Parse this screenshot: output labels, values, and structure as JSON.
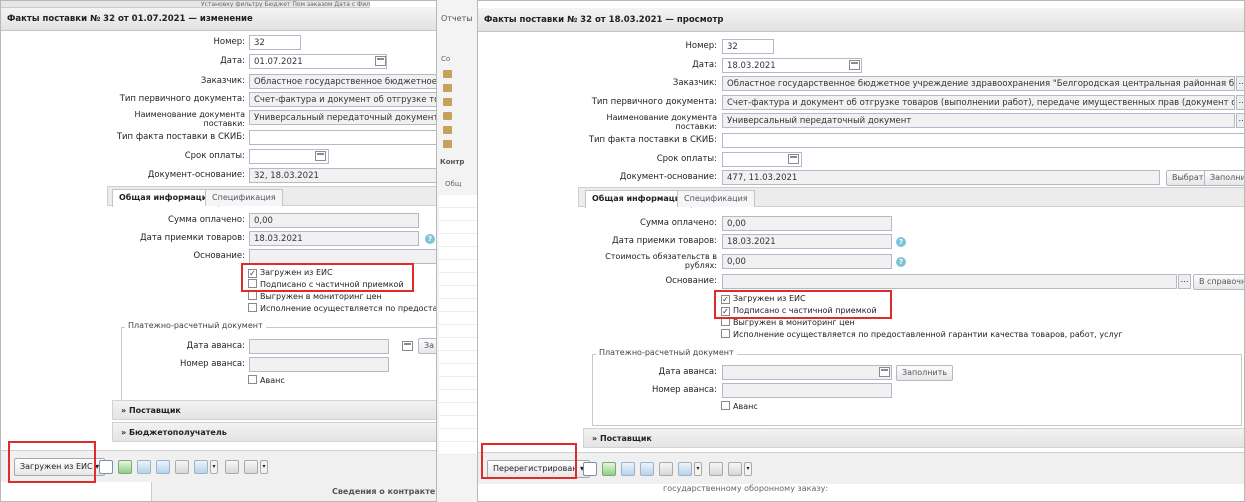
{
  "left": {
    "strip_text": "Установку фильтру Бюджет Пом заказом Дата с Фил",
    "title": "Факты поставки № 32 от 01.07.2021 — изменение",
    "fields": {
      "nomer_label": "Номер:",
      "nomer": "32",
      "data_label": "Дата:",
      "data": "01.07.2021",
      "zakazchik_label": "Заказчик:",
      "zakazchik": "Областное государственное бюджетное учрежд",
      "tip_label": "Тип первичного документа:",
      "tip": "Счет-фактура и документ об отгрузке товаров",
      "naim_label": "Наименование документа поставки:",
      "naim": "Универсальный передаточный документ",
      "skib_label": "Тип факта поставки в СКИБ:",
      "srok_label": "Срок оплаты:",
      "osnov_label": "Документ-основание:",
      "osnov": "32, 18.03.2021"
    },
    "tabs": [
      "Общая информация",
      "Спецификация"
    ],
    "general": {
      "summa_label": "Сумма оплачено:",
      "summa": "0,00",
      "priemka_label": "Дата приемки товаров:",
      "priemka": "18.03.2021",
      "osnovanie_label": "Основание:"
    },
    "checks": [
      {
        "label": "Загружен из ЕИС",
        "checked": true
      },
      {
        "label": "Подписано с частичной приемкой",
        "checked": false
      },
      {
        "label": "Выгружен в мониторинг цен",
        "checked": false
      },
      {
        "label": "Исполнение осуществляется по предоставл",
        "checked": false
      }
    ],
    "payment": {
      "title": "Платежно-расчетный документ",
      "avans_date_label": "Дата аванса:",
      "avans_num_label": "Номер аванса:",
      "avans_check": "Аванс",
      "fill_btn": "За"
    },
    "sections": [
      "Поставщик",
      "Бюджетополучатель"
    ],
    "toolbar_status": "Загружен из ЕИС",
    "below": "Сведения о контракте в Е"
  },
  "bg_window": {
    "header": "Отчеты",
    "tabs": [
      "Отчеты",
      "Со",
      "Контр",
      "Общ"
    ]
  },
  "right": {
    "title": "Факты поставки № 32 от 18.03.2021 — просмотр",
    "fields": {
      "nomer_label": "Номер:",
      "nomer": "32",
      "data_label": "Дата:",
      "data": "18.03.2021",
      "zakazchik_label": "Заказчик:",
      "zakazchik": "Областное государственное бюджетное учреждение здравоохранения \"Белгородская центральная районная больница\"",
      "tip_label": "Тип первичного документа:",
      "tip": "Счет-фактура и документ об отгрузке товаров (выполнении работ), передаче имущественных прав (документ об оказании услуг)",
      "naim_label": "Наименование документа поставки:",
      "naim": "Универсальный передаточный документ",
      "skib_label": "Тип факта поставки в СКИБ:",
      "srok_label": "Срок оплаты:",
      "osnov_label": "Документ-основание:",
      "osnov": "477, 11.03.2021",
      "vybrat": "Выбрать",
      "zapolnit": "Заполнить"
    },
    "tabs": [
      "Общая информация",
      "Спецификация"
    ],
    "general": {
      "summa_label": "Сумма оплачено:",
      "summa": "0,00",
      "priemka_label": "Дата приемки товаров:",
      "priemka": "18.03.2021",
      "stoimost_label": "Стоимость обязательств в рублях:",
      "stoimost": "0,00",
      "osnovanie_label": "Основание:",
      "sprav_btn": "В справочник"
    },
    "checks": [
      {
        "label": "Загружен из ЕИС",
        "checked": true
      },
      {
        "label": "Подписано с частичной приемкой",
        "checked": true
      },
      {
        "label": "Выгружен в мониторинг цен",
        "checked": false
      },
      {
        "label": "Исполнение осуществляется по предоставленной гарантии качества товаров, работ, услуг",
        "checked": false
      }
    ],
    "payment": {
      "title": "Платежно-расчетный документ",
      "avans_date_label": "Дата аванса:",
      "avans_num_label": "Номер аванса:",
      "avans_check": "Аванс",
      "fill_btn": "Заполнить"
    },
    "sections": [
      "Поставщик"
    ],
    "toolbar_status": "Перерегистрирован",
    "below": "государственному оборонному заказу:"
  },
  "colors": {
    "highlight": "#e02b2b",
    "accent": "#7fc4d6"
  }
}
